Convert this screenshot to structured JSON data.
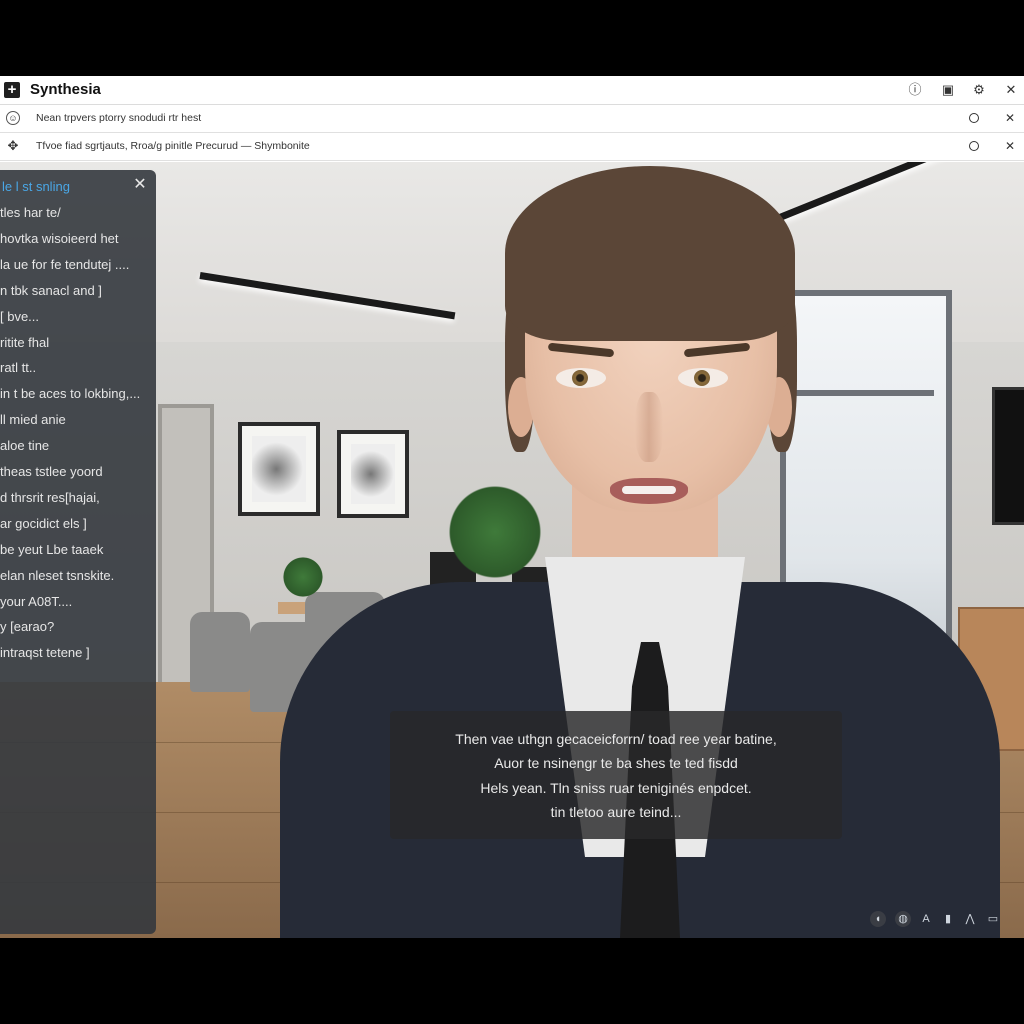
{
  "app": {
    "title": "Synthesia"
  },
  "titlebar": {
    "logo_glyph": "+",
    "icons": [
      "info-icon",
      "save-icon",
      "settings-icon",
      "close-icon"
    ],
    "info_glyph": "ⓘ",
    "save_glyph": "▣",
    "settings_glyph": "⚙",
    "close_glyph": "✕"
  },
  "notifications": [
    {
      "icon": "emoji-icon",
      "icon_glyph": "☺",
      "text": "Nean trpvers ptorry snodudi rtr hest",
      "close_glyph": "✕"
    },
    {
      "icon": "move-icon",
      "icon_glyph": "✥",
      "text": "Tfvoe fiad sgrtjauts, Rroa/g pinitle Precurud — Shymbonite",
      "close_glyph": "✕"
    }
  ],
  "panel": {
    "title": "le l st snling",
    "close_glyph": "✕",
    "lines": [
      "tles har te/",
      "hovtka wisoieerd het",
      "la ue for fe tendutej ....",
      "n tbk sanacl and ]",
      "[ bve...",
      "ritite fhal",
      "   ratl tt..",
      "in t be aces to lokbing,...",
      "ll mied anie",
      "aloe tine",
      "theas tstlee yoord",
      "d thrsrit res[hajai,",
      "ar gocidict els ]",
      "be yeut Lbe taaek",
      "elan nleset tsnskite.",
      " your A08T....",
      "y [earao?",
      "intraqst tetene ]"
    ]
  },
  "subtitle": {
    "lines": [
      "Then vae uthgn gecaceicforrn/ toad ree year batine,",
      "Auor te nsinengr te ba shes te ted fisdd",
      "Hels yean. Tln sniss ruar teniginés enpdcet.",
      "tin tletoo aure teind..."
    ]
  },
  "controls": {
    "icons": [
      {
        "name": "audio-icon",
        "glyph": "◖"
      },
      {
        "name": "globe-icon",
        "glyph": "◍"
      },
      {
        "name": "text-size-icon",
        "glyph": "A"
      },
      {
        "name": "bookmark-icon",
        "glyph": "▮"
      },
      {
        "name": "triangle-icon",
        "glyph": "⋀"
      },
      {
        "name": "gamepad-icon",
        "glyph": "▭"
      }
    ]
  },
  "colors": {
    "accent": "#4aa7e6",
    "panel_bg": "#34383e",
    "suit": "#262b37"
  }
}
